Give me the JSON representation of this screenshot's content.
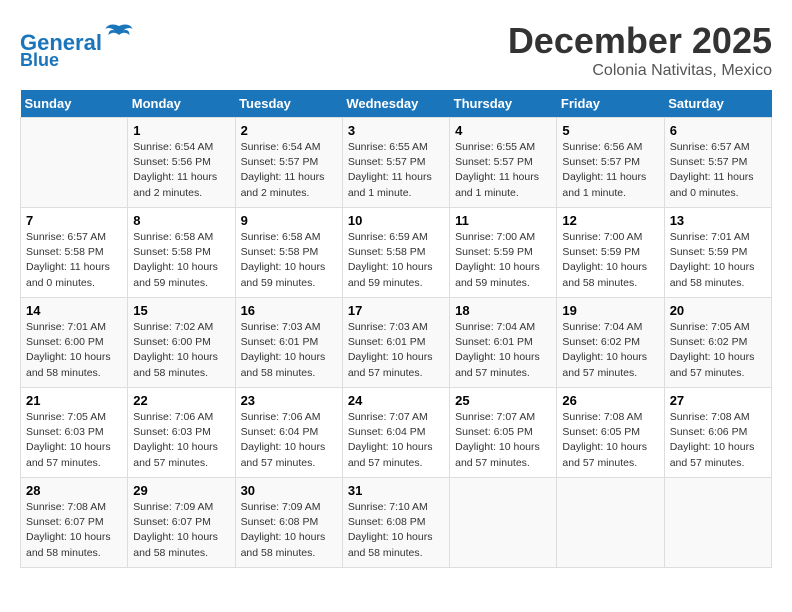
{
  "header": {
    "logo_line1": "General",
    "logo_line2": "Blue",
    "month": "December 2025",
    "location": "Colonia Nativitas, Mexico"
  },
  "weekdays": [
    "Sunday",
    "Monday",
    "Tuesday",
    "Wednesday",
    "Thursday",
    "Friday",
    "Saturday"
  ],
  "weeks": [
    [
      {
        "day": "",
        "info": ""
      },
      {
        "day": "1",
        "info": "Sunrise: 6:54 AM\nSunset: 5:56 PM\nDaylight: 11 hours\nand 2 minutes."
      },
      {
        "day": "2",
        "info": "Sunrise: 6:54 AM\nSunset: 5:57 PM\nDaylight: 11 hours\nand 2 minutes."
      },
      {
        "day": "3",
        "info": "Sunrise: 6:55 AM\nSunset: 5:57 PM\nDaylight: 11 hours\nand 1 minute."
      },
      {
        "day": "4",
        "info": "Sunrise: 6:55 AM\nSunset: 5:57 PM\nDaylight: 11 hours\nand 1 minute."
      },
      {
        "day": "5",
        "info": "Sunrise: 6:56 AM\nSunset: 5:57 PM\nDaylight: 11 hours\nand 1 minute."
      },
      {
        "day": "6",
        "info": "Sunrise: 6:57 AM\nSunset: 5:57 PM\nDaylight: 11 hours\nand 0 minutes."
      }
    ],
    [
      {
        "day": "7",
        "info": "Sunrise: 6:57 AM\nSunset: 5:58 PM\nDaylight: 11 hours\nand 0 minutes."
      },
      {
        "day": "8",
        "info": "Sunrise: 6:58 AM\nSunset: 5:58 PM\nDaylight: 10 hours\nand 59 minutes."
      },
      {
        "day": "9",
        "info": "Sunrise: 6:58 AM\nSunset: 5:58 PM\nDaylight: 10 hours\nand 59 minutes."
      },
      {
        "day": "10",
        "info": "Sunrise: 6:59 AM\nSunset: 5:58 PM\nDaylight: 10 hours\nand 59 minutes."
      },
      {
        "day": "11",
        "info": "Sunrise: 7:00 AM\nSunset: 5:59 PM\nDaylight: 10 hours\nand 59 minutes."
      },
      {
        "day": "12",
        "info": "Sunrise: 7:00 AM\nSunset: 5:59 PM\nDaylight: 10 hours\nand 58 minutes."
      },
      {
        "day": "13",
        "info": "Sunrise: 7:01 AM\nSunset: 5:59 PM\nDaylight: 10 hours\nand 58 minutes."
      }
    ],
    [
      {
        "day": "14",
        "info": "Sunrise: 7:01 AM\nSunset: 6:00 PM\nDaylight: 10 hours\nand 58 minutes."
      },
      {
        "day": "15",
        "info": "Sunrise: 7:02 AM\nSunset: 6:00 PM\nDaylight: 10 hours\nand 58 minutes."
      },
      {
        "day": "16",
        "info": "Sunrise: 7:03 AM\nSunset: 6:01 PM\nDaylight: 10 hours\nand 58 minutes."
      },
      {
        "day": "17",
        "info": "Sunrise: 7:03 AM\nSunset: 6:01 PM\nDaylight: 10 hours\nand 57 minutes."
      },
      {
        "day": "18",
        "info": "Sunrise: 7:04 AM\nSunset: 6:01 PM\nDaylight: 10 hours\nand 57 minutes."
      },
      {
        "day": "19",
        "info": "Sunrise: 7:04 AM\nSunset: 6:02 PM\nDaylight: 10 hours\nand 57 minutes."
      },
      {
        "day": "20",
        "info": "Sunrise: 7:05 AM\nSunset: 6:02 PM\nDaylight: 10 hours\nand 57 minutes."
      }
    ],
    [
      {
        "day": "21",
        "info": "Sunrise: 7:05 AM\nSunset: 6:03 PM\nDaylight: 10 hours\nand 57 minutes."
      },
      {
        "day": "22",
        "info": "Sunrise: 7:06 AM\nSunset: 6:03 PM\nDaylight: 10 hours\nand 57 minutes."
      },
      {
        "day": "23",
        "info": "Sunrise: 7:06 AM\nSunset: 6:04 PM\nDaylight: 10 hours\nand 57 minutes."
      },
      {
        "day": "24",
        "info": "Sunrise: 7:07 AM\nSunset: 6:04 PM\nDaylight: 10 hours\nand 57 minutes."
      },
      {
        "day": "25",
        "info": "Sunrise: 7:07 AM\nSunset: 6:05 PM\nDaylight: 10 hours\nand 57 minutes."
      },
      {
        "day": "26",
        "info": "Sunrise: 7:08 AM\nSunset: 6:05 PM\nDaylight: 10 hours\nand 57 minutes."
      },
      {
        "day": "27",
        "info": "Sunrise: 7:08 AM\nSunset: 6:06 PM\nDaylight: 10 hours\nand 57 minutes."
      }
    ],
    [
      {
        "day": "28",
        "info": "Sunrise: 7:08 AM\nSunset: 6:07 PM\nDaylight: 10 hours\nand 58 minutes."
      },
      {
        "day": "29",
        "info": "Sunrise: 7:09 AM\nSunset: 6:07 PM\nDaylight: 10 hours\nand 58 minutes."
      },
      {
        "day": "30",
        "info": "Sunrise: 7:09 AM\nSunset: 6:08 PM\nDaylight: 10 hours\nand 58 minutes."
      },
      {
        "day": "31",
        "info": "Sunrise: 7:10 AM\nSunset: 6:08 PM\nDaylight: 10 hours\nand 58 minutes."
      },
      {
        "day": "",
        "info": ""
      },
      {
        "day": "",
        "info": ""
      },
      {
        "day": "",
        "info": ""
      }
    ]
  ]
}
